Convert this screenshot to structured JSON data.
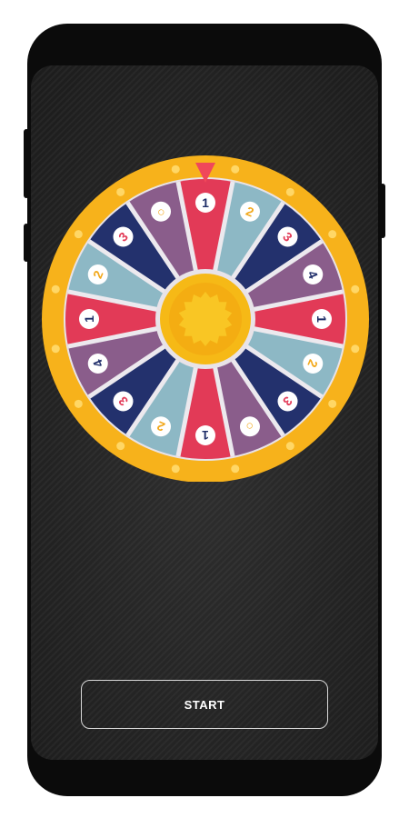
{
  "wheel": {
    "pointer_color": "#f0485a",
    "rim_color": "#f7b21b",
    "rim_dot_color": "#ffd766",
    "hub_color": "#f6b916",
    "hub_inner_color": "#f9c624",
    "segments": [
      {
        "label": "1",
        "color": "#e23a57",
        "text_color": "#1f2e68"
      },
      {
        "label": "2",
        "color": "#8db8c5",
        "text_color": "#f2a91d"
      },
      {
        "label": "3",
        "color": "#23316d",
        "text_color": "#e23a57"
      },
      {
        "label": "4",
        "color": "#8a5d8b",
        "text_color": "#23316d"
      },
      {
        "label": "1",
        "color": "#e23a57",
        "text_color": "#1f2e68"
      },
      {
        "label": "2",
        "color": "#8db8c5",
        "text_color": "#f2a91d"
      },
      {
        "label": "3",
        "color": "#23316d",
        "text_color": "#e23a57"
      },
      {
        "label": "○",
        "color": "#8a5d8b",
        "text_color": "#f2a91d"
      },
      {
        "label": "1",
        "color": "#e23a57",
        "text_color": "#1f2e68"
      },
      {
        "label": "2",
        "color": "#8db8c5",
        "text_color": "#f2a91d"
      },
      {
        "label": "3",
        "color": "#23316d",
        "text_color": "#e23a57"
      },
      {
        "label": "4",
        "color": "#8a5d8b",
        "text_color": "#23316d"
      },
      {
        "label": "1",
        "color": "#e23a57",
        "text_color": "#1f2e68"
      },
      {
        "label": "2",
        "color": "#8db8c5",
        "text_color": "#f2a91d"
      },
      {
        "label": "3",
        "color": "#23316d",
        "text_color": "#e23a57"
      },
      {
        "label": "○",
        "color": "#8a5d8b",
        "text_color": "#f2a91d"
      }
    ]
  },
  "start_button": {
    "label": "START"
  }
}
